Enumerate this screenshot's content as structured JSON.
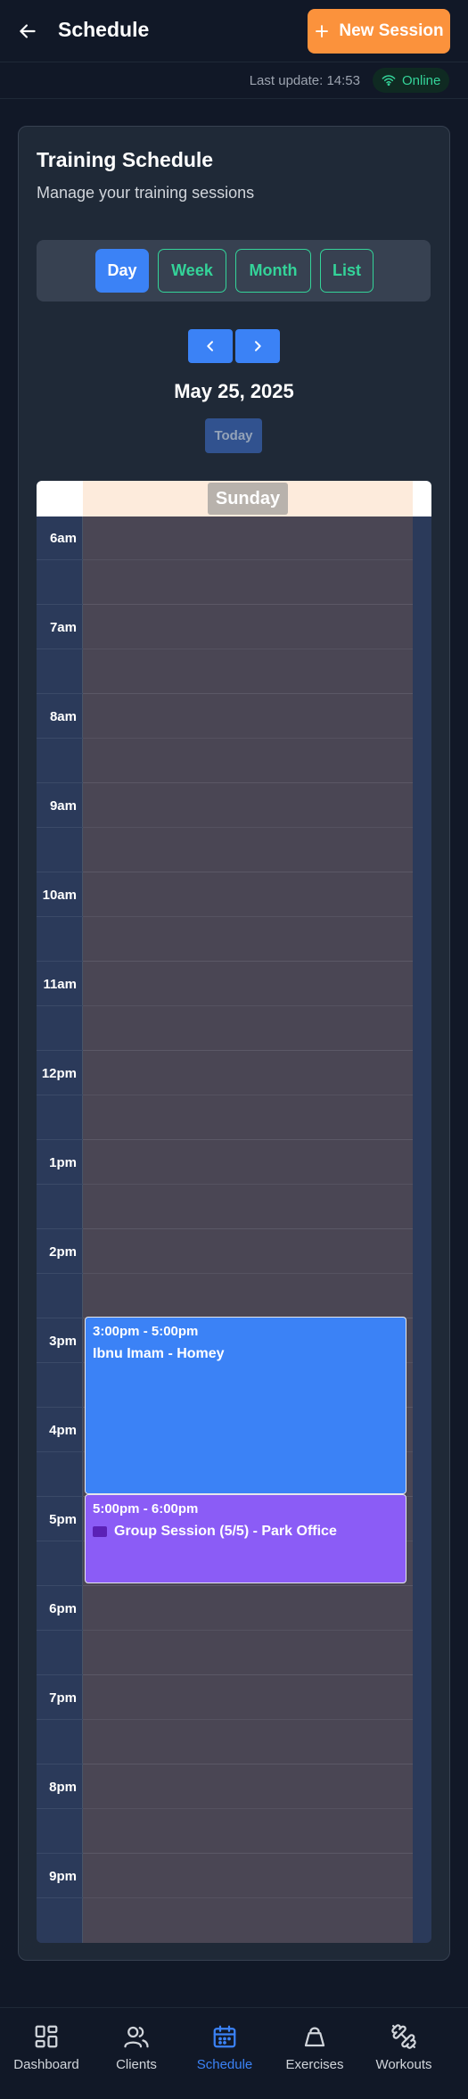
{
  "header": {
    "title": "Schedule",
    "new_session_label": "New Session"
  },
  "status": {
    "last_update": "Last update: 14:53",
    "connection": "Online"
  },
  "card": {
    "title": "Training Schedule",
    "subtitle": "Manage your training sessions"
  },
  "views": {
    "active": "Day",
    "items": [
      "Day",
      "Week",
      "Month",
      "List"
    ]
  },
  "date": "May 25, 2025",
  "today_label": "Today",
  "calendar": {
    "day_label": "Sunday",
    "time_slots": [
      "6am",
      "7am",
      "8am",
      "9am",
      "10am",
      "11am",
      "12pm",
      "1pm",
      "2pm",
      "3pm",
      "4pm",
      "5pm",
      "6pm",
      "7pm",
      "8pm",
      "9pm"
    ],
    "events": [
      {
        "time": "3:00pm - 5:00pm",
        "title": "Ibnu Imam - Homey",
        "color": "#3b82f6",
        "group": false
      },
      {
        "time": "5:00pm - 6:00pm",
        "title": "Group Session (5/5) - Park Office",
        "color": "#8b5cf6",
        "group": true
      }
    ]
  },
  "bottom_nav": {
    "active": "Schedule",
    "items": [
      "Dashboard",
      "Clients",
      "Schedule",
      "Exercises",
      "Workouts"
    ]
  },
  "colors": {
    "accent": "#3b82f6",
    "primary_action": "#fb923c",
    "online": "#34d399",
    "group_event": "#8b5cf6"
  }
}
